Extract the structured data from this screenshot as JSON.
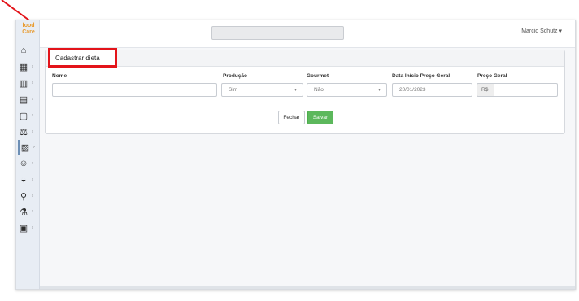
{
  "app": {
    "logo_top": "food",
    "logo_bottom": "Care",
    "user_menu": "Marcio Schutz ▾"
  },
  "sidebar": {
    "items": [
      {
        "icon": "home-icon",
        "glyph": "⌂"
      },
      {
        "icon": "grid-icon",
        "glyph": "▦"
      },
      {
        "icon": "chart-icon",
        "glyph": "▥"
      },
      {
        "icon": "book-icon",
        "glyph": "▤"
      },
      {
        "icon": "clipboard-icon",
        "glyph": "▢"
      },
      {
        "icon": "scale-icon",
        "glyph": "⚖"
      },
      {
        "icon": "diet-icon",
        "glyph": "▧"
      },
      {
        "icon": "people-icon",
        "glyph": "☺"
      },
      {
        "icon": "bowl-icon",
        "glyph": "◒"
      },
      {
        "icon": "thermometer-icon",
        "glyph": "⚲"
      },
      {
        "icon": "flask-icon",
        "glyph": "⚗"
      },
      {
        "icon": "truck-icon",
        "glyph": "▣"
      }
    ]
  },
  "form": {
    "title": "Cadastrar dieta",
    "fields": {
      "nome": {
        "label": "Nome",
        "value": ""
      },
      "producao": {
        "label": "Produção",
        "value": "Sim"
      },
      "gourmet": {
        "label": "Gourmet",
        "value": "Não"
      },
      "data_inicio": {
        "label": "Data Início Preço Geral",
        "value": "20/01/2023"
      },
      "preco_geral": {
        "label": "Preço Geral",
        "prefix": "R$",
        "value": ""
      }
    },
    "buttons": {
      "close": "Fechar",
      "save": "Salvar"
    }
  },
  "colors": {
    "highlight": "#e3141a",
    "save_button": "#5cb85c",
    "logo": "#e89a2d"
  }
}
